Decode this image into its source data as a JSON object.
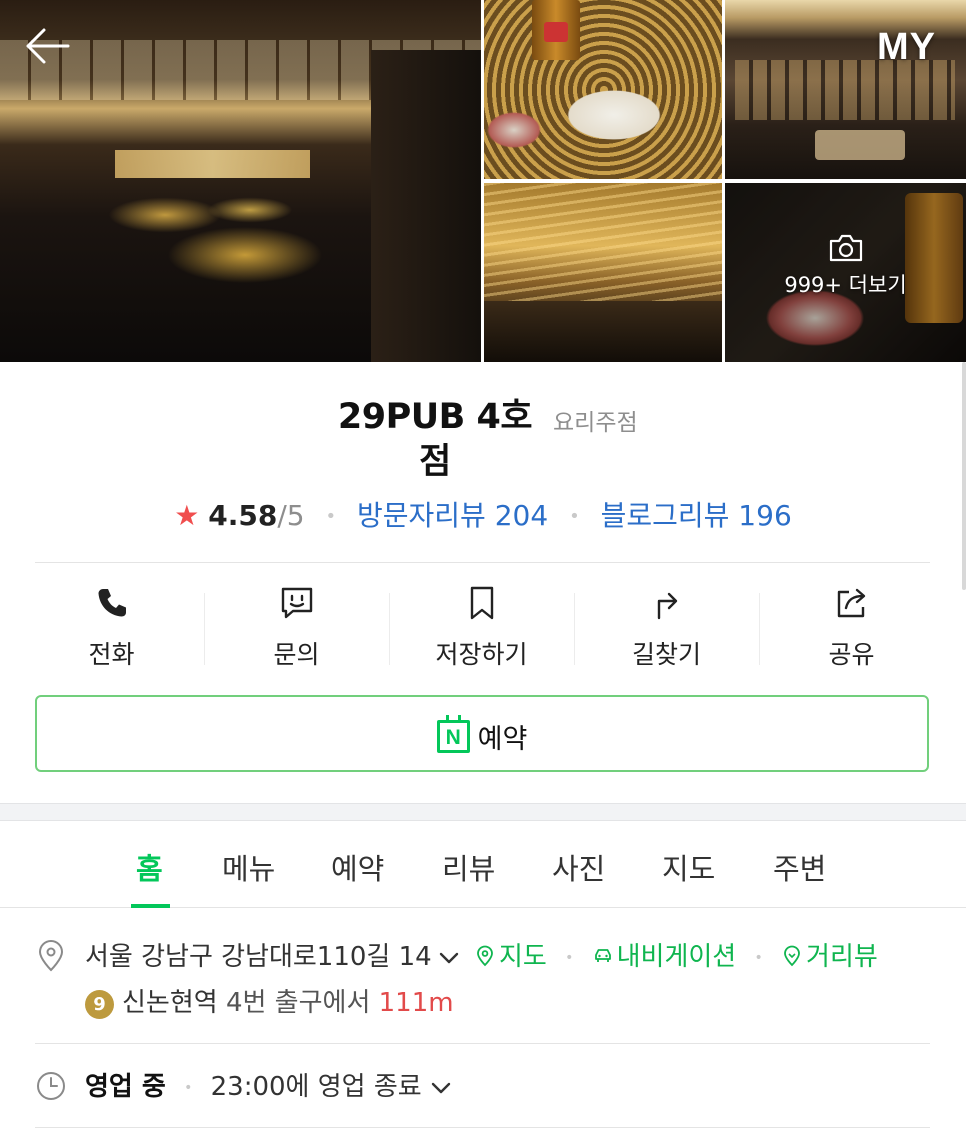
{
  "header": {
    "back_icon": "back-arrow-icon",
    "my_label": "MY",
    "photo_more_label": "999+ 더보기",
    "photo_more_icon": "camera-icon"
  },
  "place": {
    "name": "29PUB 4호점",
    "category": "요리주점",
    "rating_star": "★",
    "rating": "4.58",
    "rating_max": "/5",
    "visitor_reviews": "방문자리뷰 204",
    "blog_reviews": "블로그리뷰 196"
  },
  "actions": [
    {
      "label": "전화",
      "icon": "phone-icon"
    },
    {
      "label": "문의",
      "icon": "chat-icon"
    },
    {
      "label": "저장하기",
      "icon": "bookmark-icon"
    },
    {
      "label": "길찾기",
      "icon": "directions-icon"
    },
    {
      "label": "공유",
      "icon": "share-icon"
    }
  ],
  "reserve": {
    "label": "예약",
    "icon": "naver-calendar-icon",
    "icon_letter": "N",
    "accent": "#03c75a"
  },
  "tabs": [
    {
      "label": "홈",
      "active": true
    },
    {
      "label": "메뉴"
    },
    {
      "label": "예약"
    },
    {
      "label": "리뷰"
    },
    {
      "label": "사진"
    },
    {
      "label": "지도"
    },
    {
      "label": "주변"
    }
  ],
  "address": {
    "text": "서울 강남구 강남대로110길 14",
    "map_label": "지도",
    "navigation_label": "내비게이션",
    "streetview_label": "거리뷰"
  },
  "subway": {
    "line_number": "9",
    "line_color": "#bd9a3e",
    "station": "신논현역",
    "exit": "4번 출구에서",
    "distance": "111m"
  },
  "hours": {
    "status": "영업 중",
    "detail": "23:00에 영업 종료"
  },
  "colors": {
    "green": "#03c75a",
    "link_blue": "#2b6ec8",
    "star_red": "#f04e4e"
  }
}
